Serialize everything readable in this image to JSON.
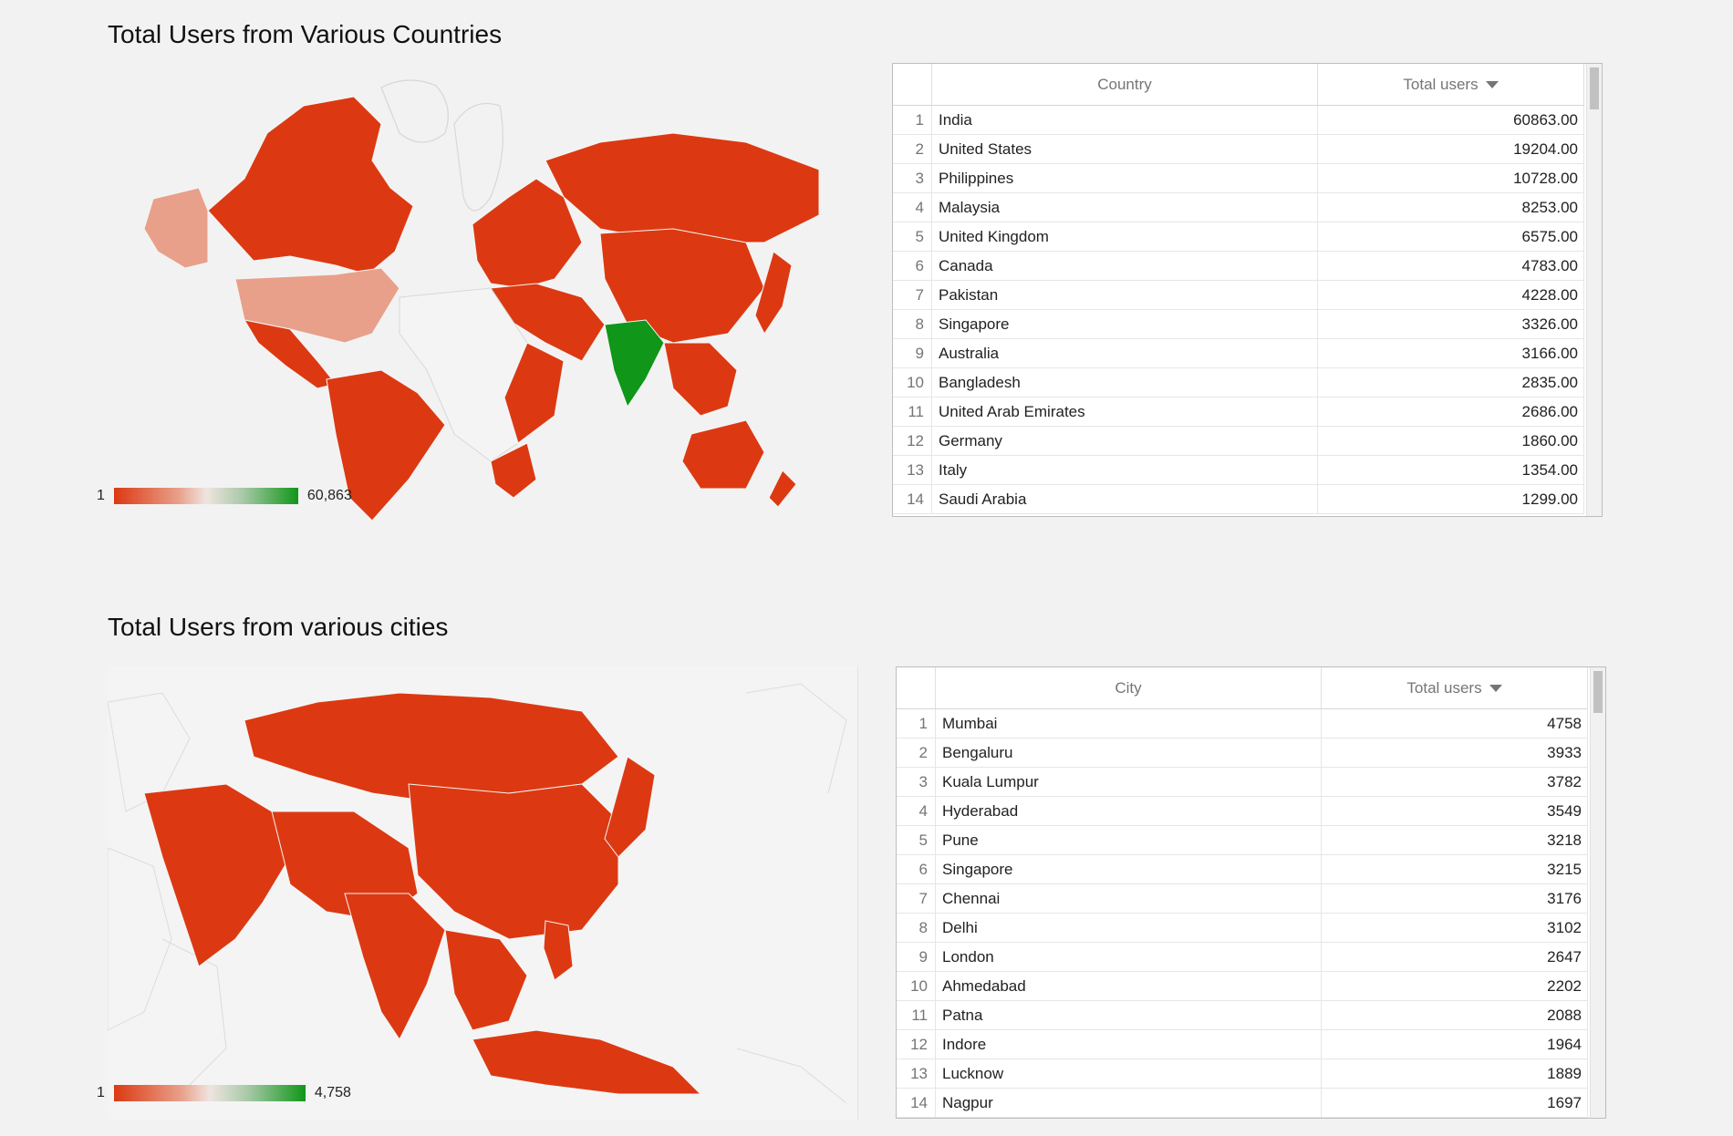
{
  "countries_section": {
    "title": "Total Users from Various Countries",
    "legend": {
      "min": "1",
      "max": "60,863"
    },
    "table": {
      "col_name": "Country",
      "col_value": "Total users",
      "rows": [
        {
          "idx": "1",
          "name": "India",
          "value": "60863.00"
        },
        {
          "idx": "2",
          "name": "United States",
          "value": "19204.00"
        },
        {
          "idx": "3",
          "name": "Philippines",
          "value": "10728.00"
        },
        {
          "idx": "4",
          "name": "Malaysia",
          "value": "8253.00"
        },
        {
          "idx": "5",
          "name": "United Kingdom",
          "value": "6575.00"
        },
        {
          "idx": "6",
          "name": "Canada",
          "value": "4783.00"
        },
        {
          "idx": "7",
          "name": "Pakistan",
          "value": "4228.00"
        },
        {
          "idx": "8",
          "name": "Singapore",
          "value": "3326.00"
        },
        {
          "idx": "9",
          "name": "Australia",
          "value": "3166.00"
        },
        {
          "idx": "10",
          "name": "Bangladesh",
          "value": "2835.00"
        },
        {
          "idx": "11",
          "name": "United Arab Emirates",
          "value": "2686.00"
        },
        {
          "idx": "12",
          "name": "Germany",
          "value": "1860.00"
        },
        {
          "idx": "13",
          "name": "Italy",
          "value": "1354.00"
        },
        {
          "idx": "14",
          "name": "Saudi Arabia",
          "value": "1299.00"
        }
      ]
    }
  },
  "cities_section": {
    "title": "Total Users from various cities",
    "legend": {
      "min": "1",
      "max": "4,758"
    },
    "table": {
      "col_name": "City",
      "col_value": "Total users",
      "rows": [
        {
          "idx": "1",
          "name": "Mumbai",
          "value": "4758"
        },
        {
          "idx": "2",
          "name": "Bengaluru",
          "value": "3933"
        },
        {
          "idx": "3",
          "name": "Kuala Lumpur",
          "value": "3782"
        },
        {
          "idx": "4",
          "name": "Hyderabad",
          "value": "3549"
        },
        {
          "idx": "5",
          "name": "Pune",
          "value": "3218"
        },
        {
          "idx": "6",
          "name": "Singapore",
          "value": "3215"
        },
        {
          "idx": "7",
          "name": "Chennai",
          "value": "3176"
        },
        {
          "idx": "8",
          "name": "Delhi",
          "value": "3102"
        },
        {
          "idx": "9",
          "name": "London",
          "value": "2647"
        },
        {
          "idx": "10",
          "name": "Ahmedabad",
          "value": "2202"
        },
        {
          "idx": "11",
          "name": "Patna",
          "value": "2088"
        },
        {
          "idx": "12",
          "name": "Indore",
          "value": "1964"
        },
        {
          "idx": "13",
          "name": "Lucknow",
          "value": "1889"
        },
        {
          "idx": "14",
          "name": "Nagpur",
          "value": "1697"
        }
      ]
    }
  },
  "colors": {
    "low": "#dc3912",
    "mid": "#e8a08a",
    "high": "#109618",
    "empty": "#f4f4f4",
    "border": "#d8d8d8"
  }
}
